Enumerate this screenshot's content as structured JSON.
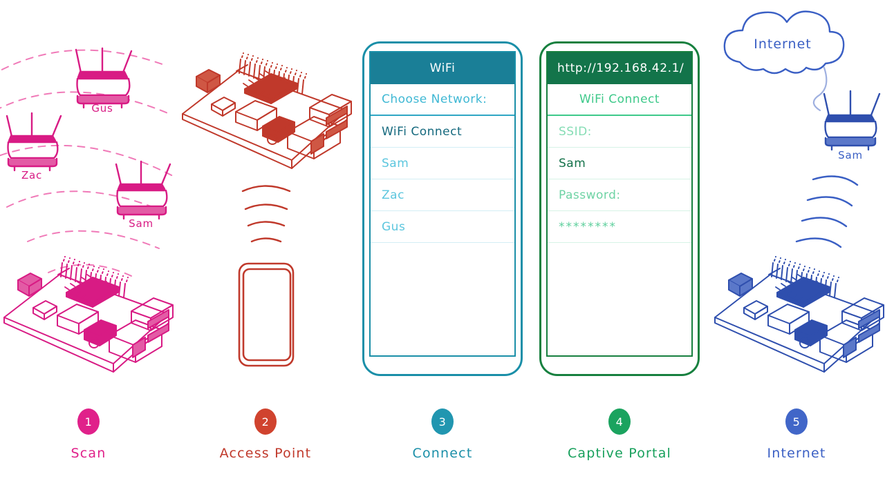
{
  "diagram": {
    "title_visible": false,
    "steps": [
      {
        "number": "1",
        "label": "Scan",
        "color": "#e0218a",
        "marker_color": "#e0218a",
        "art": "scan",
        "networks": [
          "Gus",
          "Zac",
          "Sam"
        ],
        "device": "raspberry-pi"
      },
      {
        "number": "2",
        "label": "Access Point",
        "color": "#c0392b",
        "marker_color": "#d0432e",
        "art": "access-point",
        "device": "raspberry-pi",
        "client": "phone"
      },
      {
        "number": "3",
        "label": "Connect",
        "color": "#1a8fa8",
        "marker_color": "#2196b0",
        "art": "phone-wifi-list",
        "phone": {
          "bar_title": "WiFi",
          "bar_align": "center",
          "bar_color": "#1a7f97",
          "heading": "Choose Network:",
          "rows": [
            {
              "text": "Choose Network:",
              "style": "muted"
            },
            {
              "text": "WiFi Connect",
              "style": "selected"
            },
            {
              "text": "Sam",
              "style": "muted"
            },
            {
              "text": "Zac",
              "style": "muted"
            },
            {
              "text": "Gus",
              "style": "muted"
            }
          ]
        }
      },
      {
        "number": "4",
        "label": "Captive Portal",
        "color": "#17a05c",
        "marker_color": "#1ba35f",
        "art": "phone-captive-portal",
        "phone": {
          "bar_title": "http://192.168.42.1/",
          "bar_align": "left",
          "bar_color": "#13744a",
          "rows": [
            {
              "text": "WiFi Connect",
              "style": "title"
            },
            {
              "text": "SSID:",
              "style": "muted"
            },
            {
              "text": "Sam",
              "style": "value"
            },
            {
              "text": "Password:",
              "style": "muted"
            },
            {
              "text": "********",
              "style": "muted"
            }
          ]
        }
      },
      {
        "number": "5",
        "label": "Internet",
        "color": "#3a5fc4",
        "marker_color": "#4166c8",
        "art": "internet",
        "cloud_label": "Internet",
        "router_label": "Sam",
        "device": "raspberry-pi"
      }
    ]
  }
}
